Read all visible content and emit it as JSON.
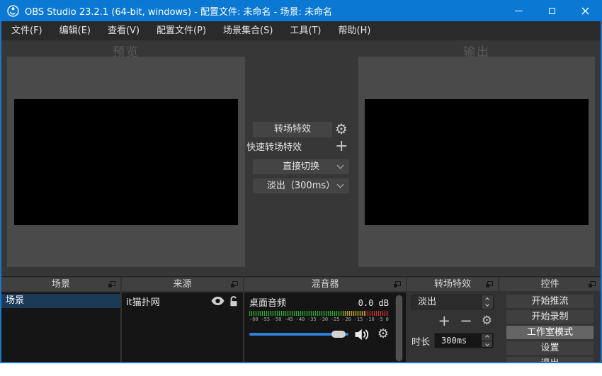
{
  "titlebar": {
    "title": "OBS Studio 23.2.1 (64-bit, windows) - 配置文件: 未命名 - 场景: 未命名"
  },
  "menu": {
    "items": [
      "文件(F)",
      "编辑(E)",
      "查看(V)",
      "配置文件(P)",
      "场景集合(S)",
      "工具(T)",
      "帮助(H)"
    ]
  },
  "studio": {
    "preview_label": "预览",
    "program_label": "输出",
    "transitions_button": "转场特效",
    "quick_transitions_label": "快速转场特效",
    "transition_select": "直接切换",
    "quick_transition_select": "淡出（300ms）"
  },
  "scenes_dock": {
    "title": "场景",
    "selected_item": "场景"
  },
  "sources_dock": {
    "title": "来源",
    "item": "it猫扑网"
  },
  "mixer_dock": {
    "title": "混音器",
    "channel_name": "桌面音频",
    "volume": "0.0 dB",
    "scale": [
      "-60",
      "-55",
      "-50",
      "-45",
      "-40",
      "-35",
      "-30",
      "-25",
      "-20",
      "-15",
      "-10",
      "-5",
      "0"
    ]
  },
  "transitions_dock": {
    "title": "转场特效",
    "transition": "淡出",
    "duration_label": "时长",
    "duration": "300ms"
  },
  "controls_dock": {
    "title": "控件",
    "stream": "开始推流",
    "record": "开始录制",
    "studio_mode": "工作室模式",
    "settings": "设置",
    "exit": "退出"
  },
  "colors": {
    "titlebar": "#0b79d4",
    "window_border": "#1a76d2",
    "selected_row": "#1a3a58",
    "slider_blue": "#2e7fd6",
    "meter_green": "#3e9e3e",
    "meter_yellow": "#b0a23a",
    "meter_red": "#b04040"
  }
}
